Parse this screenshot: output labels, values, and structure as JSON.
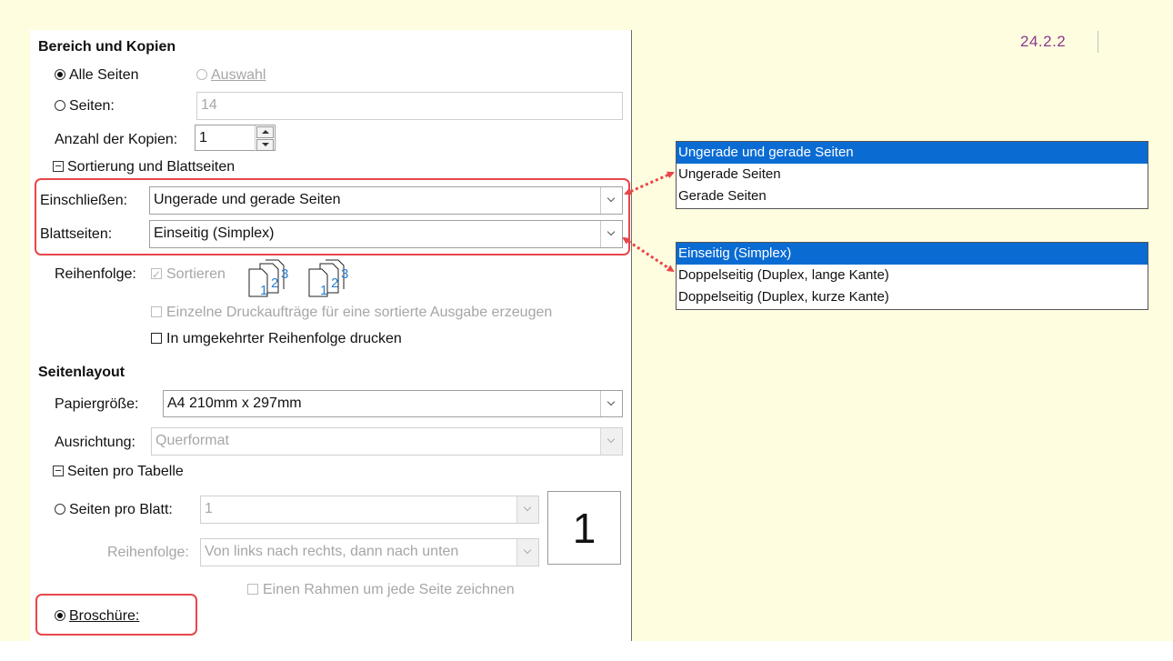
{
  "version": "24.2.2",
  "section_range": {
    "title": "Bereich und Kopien",
    "all_pages": "Alle Seiten",
    "selection": "Auswahl",
    "pages_label": "Seiten:",
    "pages_value": "14",
    "copies_label": "Anzahl der Kopien:",
    "copies_value": "1",
    "collate_header": "Sortierung und Blattseiten",
    "include_label": "Einschließen:",
    "include_value": "Ungerade und gerade Seiten",
    "sides_label": "Blattseiten:",
    "sides_value": "Einseitig (Simplex)",
    "order_label": "Reihenfolge:",
    "sort_label": "Sortieren",
    "separate_jobs": "Einzelne Druckaufträge für eine sortierte Ausgabe erzeugen",
    "reverse_order": "In umgekehrter Reihenfolge drucken",
    "sort_icon_digits": [
      "1",
      "2",
      "3"
    ]
  },
  "section_layout": {
    "title": "Seitenlayout",
    "paper_label": "Papiergröße:",
    "paper_value": "A4 210mm x 297mm",
    "orientation_label": "Ausrichtung:",
    "orientation_value": "Querformat",
    "pages_per_table_header": "Seiten pro Tabelle",
    "pages_per_sheet_label": "Seiten pro Blatt:",
    "pages_per_sheet_value": "1",
    "order_label": "Reihenfolge:",
    "order_value": "Von links nach rechts, dann nach unten",
    "frame_label": "Einen Rahmen um jede Seite zeichnen",
    "brochure_label": "Broschüre:",
    "preview_number": "1"
  },
  "include_options": [
    "Ungerade und gerade Seiten",
    "Ungerade Seiten",
    "Gerade Seiten"
  ],
  "sides_options": [
    "Einseitig (Simplex)",
    "Doppelseitig (Duplex, lange Kante)",
    "Doppelseitig (Duplex, kurze Kante)"
  ],
  "colors": {
    "background": "#fffde0",
    "highlight": "#e8464a",
    "selection": "#0a6cd3",
    "version_text": "#8b3a8b"
  }
}
